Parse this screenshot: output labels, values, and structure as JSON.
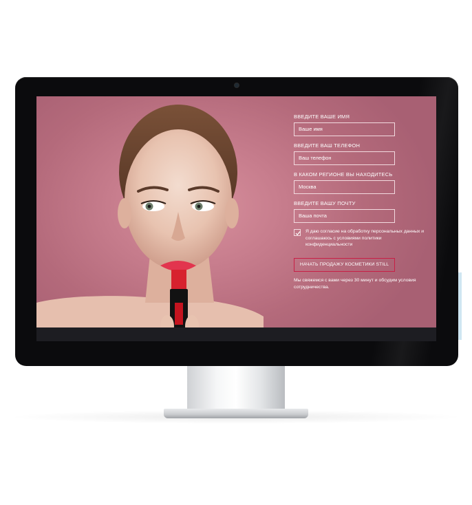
{
  "form": {
    "name_label": "ВВЕДИТЕ ВАШЕ ИМЯ",
    "name_value": "Ваше имя",
    "phone_label": "ВВЕДИТЕ ВАШ ТЕЛЕФОН",
    "phone_value": "Ваш телефон",
    "region_label": "В КАКОМ РЕГИОНЕ ВЫ НАХОДИТЕСЬ",
    "region_value": "Москва",
    "email_label": "ВВЕДИТЕ ВАШУ ПОЧТУ",
    "email_value": "Ваша почта",
    "consent_text": "Я даю согласие на обработку персональных данных и соглашаюсь с условиями политики конфиденциальности",
    "consent_checked": true,
    "submit_label": "НАЧАТЬ ПРОДАЖУ КОСМЕТИКИ STILL",
    "note": "Мы свяжемся с вами через 30 минут и обсудим условия сотрудничества."
  },
  "colors": {
    "screen_bg": "#b86d7e",
    "cta_border": "#c81e45",
    "bezel": "#0b0b0d"
  },
  "icons": {
    "checkbox": "check-icon",
    "camera": "webcam-icon"
  }
}
